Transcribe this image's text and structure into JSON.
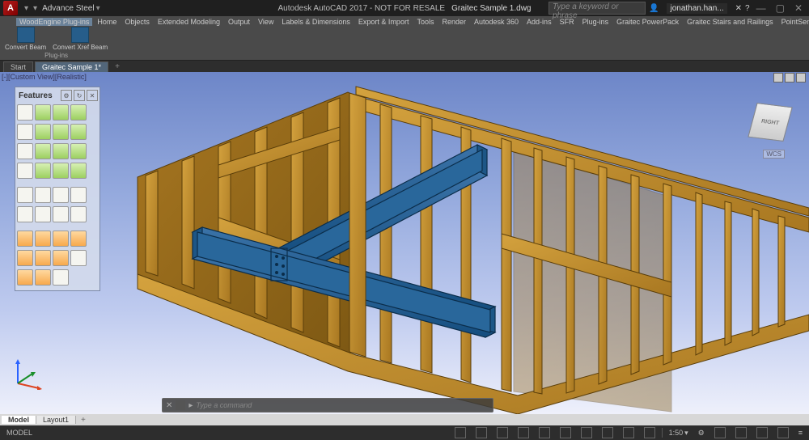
{
  "title": {
    "app": "Autodesk AutoCAD 2017 - NOT FOR RESALE",
    "doc": "Graitec Sample 1.dwg"
  },
  "qat_label": "Advance Steel",
  "search_placeholder": "Type a keyword or phrase",
  "user": "jonathan.han...",
  "menu": [
    "WoodEngine Plug-ins",
    "Home",
    "Objects",
    "Extended Modeling",
    "Output",
    "View",
    "Labels & Dimensions",
    "Export & Import",
    "Tools",
    "Render",
    "Autodesk 360",
    "Add-ins",
    "SFR",
    "Plug-ins",
    "Graitec PowerPack",
    "Graitec Stairs and Railings",
    "PointSense Plant"
  ],
  "ribbon": {
    "group": "Plug-ins",
    "btns": [
      {
        "label": "Convert Beam"
      },
      {
        "label": "Convert Xref Beam"
      }
    ]
  },
  "doctabs": [
    {
      "label": "Start",
      "active": false
    },
    {
      "label": "Graitec Sample 1*",
      "active": true
    }
  ],
  "viewport_label": "[-][Custom View][Realistic]",
  "features_title": "Features",
  "wcs": "WCS",
  "viewcube": "RIGHT",
  "cmd_placeholder": "Type a command",
  "bottom_tabs": [
    {
      "label": "Model",
      "active": true
    },
    {
      "label": "Layout1",
      "active": false
    }
  ],
  "status": {
    "left": "MODEL",
    "scale": "1:50",
    "gear": "⚙"
  }
}
